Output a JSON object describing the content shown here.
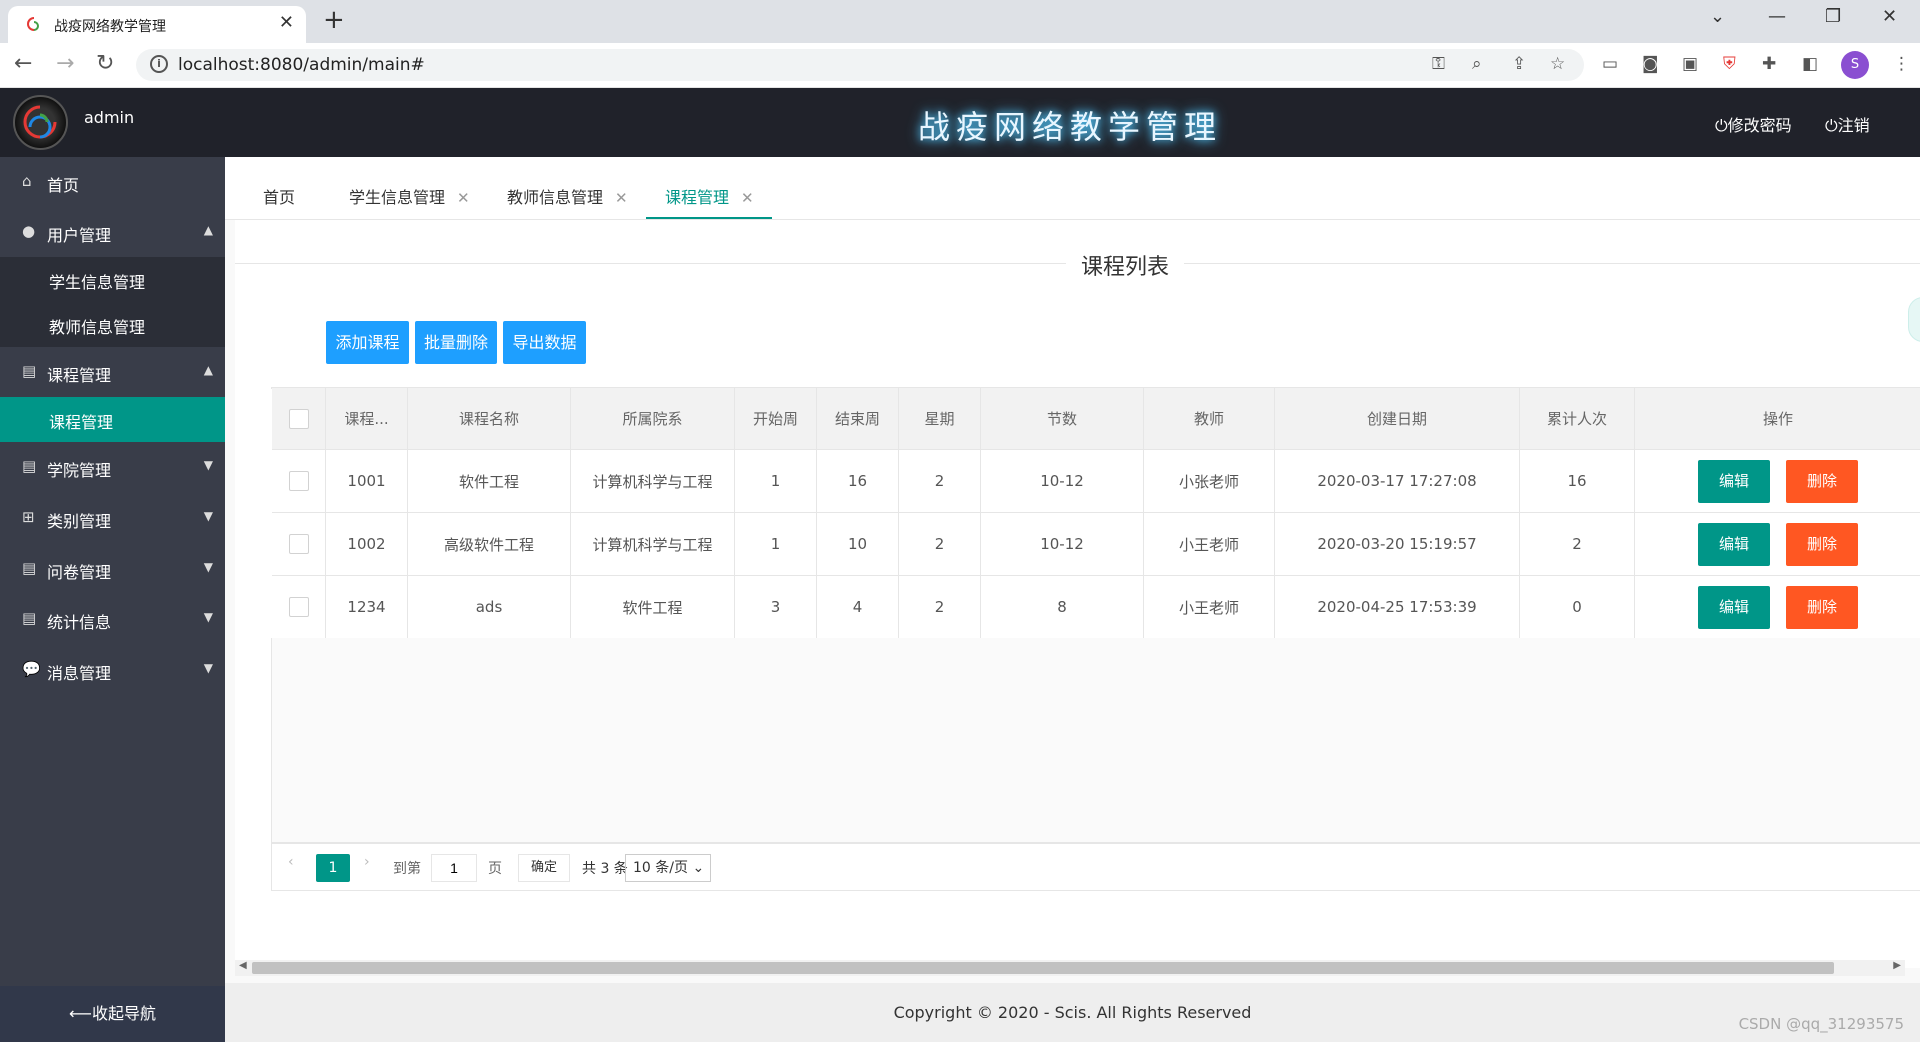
{
  "browser": {
    "tab_title": "战疫网络教学管理",
    "url": "localhost:8080/admin/main#",
    "profile_initial": "S"
  },
  "header": {
    "user": "admin",
    "title": "战疫网络教学管理",
    "change_password": "修改密码",
    "logout": "注销"
  },
  "sidebar": {
    "home": "首页",
    "user_mgmt": "用户管理",
    "student_info": "学生信息管理",
    "teacher_info": "教师信息管理",
    "course_mgmt": "课程管理",
    "course_sub": "课程管理",
    "college_mgmt": "学院管理",
    "category_mgmt": "类别管理",
    "survey_mgmt": "问卷管理",
    "stats": "统计信息",
    "message_mgmt": "消息管理",
    "collapse": "⟵收起导航"
  },
  "tabs": [
    {
      "label": "首页"
    },
    {
      "label": "学生信息管理"
    },
    {
      "label": "教师信息管理"
    },
    {
      "label": "课程管理"
    }
  ],
  "panel": {
    "legend": "课程列表",
    "add": "添加课程",
    "batch_delete": "批量删除",
    "export": "导出数据"
  },
  "table": {
    "headers": [
      "课程...",
      "课程名称",
      "所属院系",
      "开始周",
      "结束周",
      "星期",
      "节数",
      "教师",
      "创建日期",
      "累计人次",
      "操作"
    ],
    "rows": [
      [
        "1001",
        "软件工程",
        "计算机科学与工程",
        "1",
        "16",
        "2",
        "10-12",
        "小张老师",
        "2020-03-17 17:27:08",
        "16"
      ],
      [
        "1002",
        "高级软件工程",
        "计算机科学与工程",
        "1",
        "10",
        "2",
        "10-12",
        "小王老师",
        "2020-03-20 15:19:57",
        "2"
      ],
      [
        "1234",
        "ads",
        "软件工程",
        "3",
        "4",
        "2",
        "8",
        "小王老师",
        "2020-04-25 17:53:39",
        "0"
      ]
    ],
    "edit": "编辑",
    "delete": "删除"
  },
  "pager": {
    "current": "1",
    "goto": "到第",
    "page_input": "1",
    "page_unit": "页",
    "ok": "确定",
    "total": "共 3 条",
    "page_size": "10 条/页"
  },
  "footer": "Copyright © 2020 - Scis. All Rights Reserved",
  "watermark": "CSDN @qq_31293575",
  "colors": {
    "teal": "#009688",
    "blue": "#1e9fff",
    "orange": "#ff5722",
    "sidebar": "#393d49",
    "header": "#20222a"
  }
}
